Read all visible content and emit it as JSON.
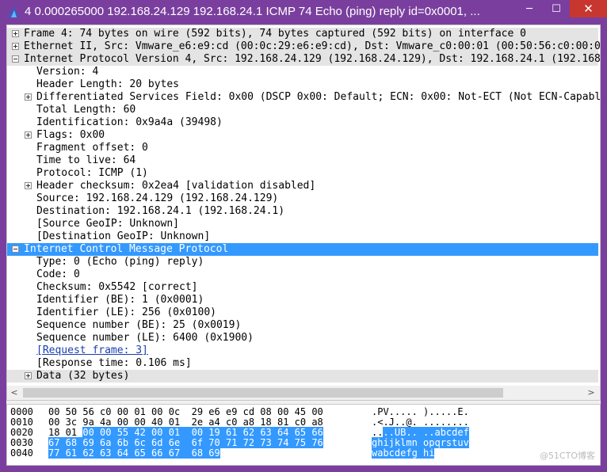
{
  "window": {
    "title": "4 0.000265000 192.168.24.129 192.168.24.1 ICMP 74 Echo (ping) reply     id=0x0001, ...",
    "minimize": "─",
    "maximize": "☐",
    "close": "✕"
  },
  "tree": [
    {
      "text": "Frame 4: 74 bytes on wire (592 bits), 74 bytes captured (592 bits) on interface 0",
      "exp": "plus",
      "level": 0,
      "style": "shade"
    },
    {
      "text": "Ethernet II, Src: Vmware_e6:e9:cd (00:0c:29:e6:e9:cd), Dst: Vmware_c0:00:01 (00:50:56:c0:00:01)",
      "exp": "plus",
      "level": 0,
      "style": "shade"
    },
    {
      "text": "Internet Protocol Version 4, Src: 192.168.24.129 (192.168.24.129), Dst: 192.168.24.1 (192.168.24.1)",
      "exp": "minus",
      "level": 0,
      "style": "shade"
    },
    {
      "text": "Version: 4",
      "exp": "",
      "level": 1,
      "style": ""
    },
    {
      "text": "Header Length: 20 bytes",
      "exp": "",
      "level": 1,
      "style": ""
    },
    {
      "text": "Differentiated Services Field: 0x00 (DSCP 0x00: Default; ECN: 0x00: Not-ECT (Not ECN-Capable Transport))",
      "exp": "plus",
      "level": 1,
      "style": ""
    },
    {
      "text": "Total Length: 60",
      "exp": "",
      "level": 1,
      "style": ""
    },
    {
      "text": "Identification: 0x9a4a (39498)",
      "exp": "",
      "level": 1,
      "style": ""
    },
    {
      "text": "Flags: 0x00",
      "exp": "plus",
      "level": 1,
      "style": ""
    },
    {
      "text": "Fragment offset: 0",
      "exp": "",
      "level": 1,
      "style": ""
    },
    {
      "text": "Time to live: 64",
      "exp": "",
      "level": 1,
      "style": ""
    },
    {
      "text": "Protocol: ICMP (1)",
      "exp": "",
      "level": 1,
      "style": ""
    },
    {
      "text": "Header checksum: 0x2ea4 [validation disabled]",
      "exp": "plus",
      "level": 1,
      "style": ""
    },
    {
      "text": "Source: 192.168.24.129 (192.168.24.129)",
      "exp": "",
      "level": 1,
      "style": ""
    },
    {
      "text": "Destination: 192.168.24.1 (192.168.24.1)",
      "exp": "",
      "level": 1,
      "style": ""
    },
    {
      "text": "[Source GeoIP: Unknown]",
      "exp": "",
      "level": 1,
      "style": ""
    },
    {
      "text": "[Destination GeoIP: Unknown]",
      "exp": "",
      "level": 1,
      "style": ""
    },
    {
      "text": "Internet Control Message Protocol",
      "exp": "minus",
      "level": 0,
      "style": "sel"
    },
    {
      "text": "Type: 0 (Echo (ping) reply)",
      "exp": "",
      "level": 1,
      "style": ""
    },
    {
      "text": "Code: 0",
      "exp": "",
      "level": 1,
      "style": ""
    },
    {
      "text": "Checksum: 0x5542 [correct]",
      "exp": "",
      "level": 1,
      "style": ""
    },
    {
      "text": "Identifier (BE): 1 (0x0001)",
      "exp": "",
      "level": 1,
      "style": ""
    },
    {
      "text": "Identifier (LE): 256 (0x0100)",
      "exp": "",
      "level": 1,
      "style": ""
    },
    {
      "text": "Sequence number (BE): 25 (0x0019)",
      "exp": "",
      "level": 1,
      "style": ""
    },
    {
      "text": "Sequence number (LE): 6400 (0x1900)",
      "exp": "",
      "level": 1,
      "style": ""
    },
    {
      "text": "[Request frame: 3]",
      "exp": "",
      "level": 1,
      "style": "link"
    },
    {
      "text": "[Response time: 0.106 ms]",
      "exp": "",
      "level": 1,
      "style": ""
    },
    {
      "text": "Data (32 bytes)",
      "exp": "plus",
      "level": 1,
      "style": "shade"
    }
  ],
  "hex": [
    {
      "offset": "0000",
      "bytes": [
        [
          "00 50 56 c0 00 01 00 0c  29 e6 e9 cd 08 00 45 00",
          false
        ]
      ],
      "ascii": [
        [
          ".PV..... ).....E.",
          false
        ]
      ]
    },
    {
      "offset": "0010",
      "bytes": [
        [
          "00 3c 9a 4a 00 00 40 01  2e a4 c0 a8 18 81 c0 a8",
          false
        ]
      ],
      "ascii": [
        [
          ".<.J..@. ........",
          false
        ]
      ]
    },
    {
      "offset": "0020",
      "bytes": [
        [
          "18 01 ",
          false
        ],
        [
          "00 00 55 42 00 01  00 19 61 62 63 64 65 66",
          true
        ]
      ],
      "ascii": [
        [
          "..",
          false
        ],
        [
          "..UB.. ..abcdef",
          true
        ]
      ]
    },
    {
      "offset": "0030",
      "bytes": [
        [
          "67 68 69 6a 6b 6c 6d 6e  6f 70 71 72 73 74 75 76",
          true
        ]
      ],
      "ascii": [
        [
          "ghijklmn opqrstuv",
          true
        ]
      ]
    },
    {
      "offset": "0040",
      "bytes": [
        [
          "77 61 62 63 64 65 66 67  68 69",
          true
        ]
      ],
      "ascii": [
        [
          "wabcdefg hi",
          true
        ]
      ]
    }
  ],
  "watermark": "@51CTO博客",
  "colors": {
    "selection": "#3399ff",
    "titlebar": "#7a3f9e",
    "close": "#c7372f"
  }
}
